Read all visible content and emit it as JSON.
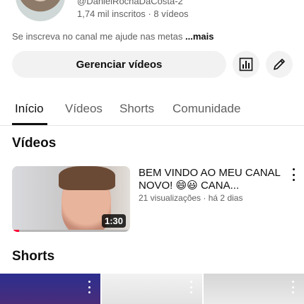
{
  "channel": {
    "handle": "@DanielRochaDaCosta-2",
    "subscribers": "1,74 mil inscritos",
    "separator": "·",
    "video_count": "8 vídeos",
    "description": "Se inscreva no canal me ajude nas metas",
    "more_label": "...mais"
  },
  "actions": {
    "manage_label": "Gerenciar vídeos",
    "stats_icon": "analytics-icon",
    "edit_icon": "pencil-icon"
  },
  "tabs": [
    {
      "label": "Início",
      "active": true
    },
    {
      "label": "Vídeos",
      "active": false
    },
    {
      "label": "Shorts",
      "active": false
    },
    {
      "label": "Comunidade",
      "active": false
    }
  ],
  "videos_section": {
    "title": "Vídeos",
    "items": [
      {
        "title": "BEM VINDO AO MEU CANAL NOVO! 😄😃 CANA...",
        "views": "21 visualizações",
        "separator": "·",
        "age": "há 2 dias",
        "duration": "1:30",
        "watched_fraction": 0.06
      }
    ]
  },
  "shorts_section": {
    "title": "Shorts"
  },
  "colors": {
    "accent": "#ff0033",
    "text_primary": "#0f0f0f",
    "text_secondary": "#606060",
    "button_bg": "#f2f2f2"
  }
}
